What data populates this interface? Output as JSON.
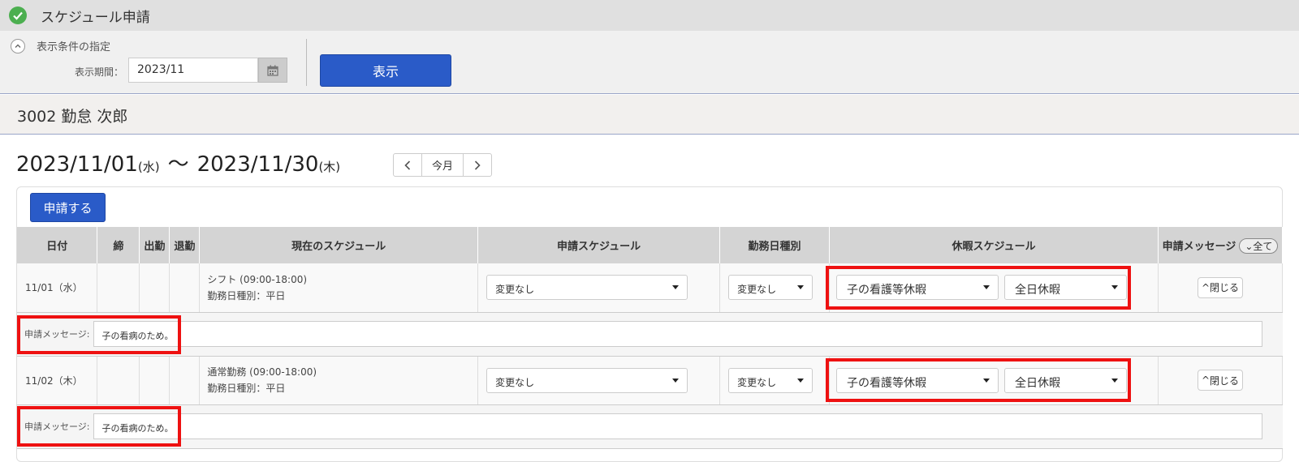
{
  "app": {
    "title": "スケジュール申請"
  },
  "filter": {
    "section_label": "表示条件の指定",
    "period_label": "表示期間：",
    "period_value": "2023/11",
    "show_button": "表示"
  },
  "employee": {
    "header": "3002 勤怠 次郎"
  },
  "range": {
    "start": "2023/11/01",
    "start_dow": "(水)",
    "tilde": "～",
    "end": "2023/11/30",
    "end_dow": "(木)",
    "nav_current": "今月"
  },
  "apply_button": "申請する",
  "columns": {
    "date": "日付",
    "close": "締",
    "in": "出勤",
    "out": "退勤",
    "current": "現在のスケジュール",
    "requested": "申請スケジュール",
    "daytype": "勤務日種別",
    "leave": "休暇スケジュール",
    "message": "申請メッセージ",
    "all": "全て"
  },
  "rows": [
    {
      "date": "11/01（水）",
      "cur_line1": "シフト (09:00-18:00)",
      "cur_line2": "勤務日種別：平日",
      "requested": "変更なし",
      "daytype": "変更なし",
      "leave_type": "子の看護等休暇",
      "leave_span": "全日休暇",
      "close_label": "閉じる",
      "msg_label": "申請メッセージ:",
      "msg_value": "子の看病のため。"
    },
    {
      "date": "11/02（木）",
      "cur_line1": "通常勤務 (09:00-18:00)",
      "cur_line2": "勤務日種別：平日",
      "requested": "変更なし",
      "daytype": "変更なし",
      "leave_type": "子の看護等休暇",
      "leave_span": "全日休暇",
      "close_label": "閉じる",
      "msg_label": "申請メッセージ:",
      "msg_value": "子の看病のため。"
    }
  ],
  "colors": {
    "accent": "#2a5bc8",
    "highlight": "#ee1111",
    "check": "#4caf50"
  }
}
